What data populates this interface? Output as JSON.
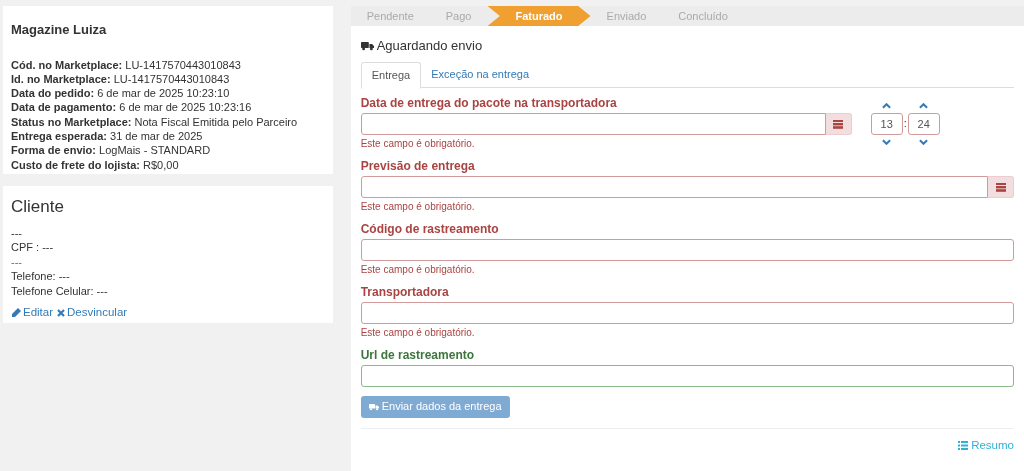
{
  "marketplace": {
    "title": "Magazine Luiza",
    "details": [
      {
        "label": "Cód. no Marketplace:",
        "value": "LU-1417570443010843"
      },
      {
        "label": "Id. no Marketplace:",
        "value": "LU-1417570443010843"
      },
      {
        "label": "Data do pedido:",
        "value": "6 de mar de 2025 10:23:10"
      },
      {
        "label": "Data de pagamento:",
        "value": "6 de mar de 2025 10:23:16"
      },
      {
        "label": "Status no Marketplace:",
        "value": "Nota Fiscal Emitida pelo Parceiro"
      },
      {
        "label": "Entrega esperada:",
        "value": "31 de mar de 2025"
      },
      {
        "label": "Forma de envio:",
        "value": "LogMais - STANDARD"
      },
      {
        "label": "Custo de frete do lojista:",
        "value": "R$0,00"
      }
    ]
  },
  "client": {
    "title": "Cliente",
    "lines": [
      {
        "text": "---",
        "kind": "plain"
      },
      {
        "text": "CPF : ---",
        "kind": "plain"
      },
      {
        "text": "---",
        "kind": "link"
      },
      {
        "text": "Telefone: ---",
        "kind": "plain"
      },
      {
        "text": "Telefone Celular: ---",
        "kind": "plain"
      }
    ],
    "actions": [
      {
        "label": "Editar",
        "kind": "edit"
      },
      {
        "label": "Desvincular",
        "kind": "unlink"
      }
    ]
  },
  "steps": [
    {
      "label": "Pendente",
      "selected": false
    },
    {
      "label": "Pago",
      "selected": false
    },
    {
      "label": "Faturado",
      "selected": true
    },
    {
      "label": "Enviado",
      "selected": false
    },
    {
      "label": "Concluído",
      "selected": false
    }
  ],
  "status_title": "Aguardando envio",
  "tabs": [
    {
      "label": "Entrega",
      "selected": true
    },
    {
      "label": "Exceção na entrega",
      "selected": false
    }
  ],
  "fields": [
    {
      "label": "Data de entrega do pacote na transportadora",
      "kind": "datetime",
      "invalid": true,
      "error": "Este campo é obrigatório.",
      "hours": "13",
      "minutes": "24",
      "separator": ":"
    },
    {
      "label": "Previsão de entrega",
      "kind": "date",
      "invalid": true,
      "error": "Este campo é obrigatório."
    },
    {
      "label": "Código de rastreamento",
      "kind": "text",
      "invalid": true,
      "error": "Este campo é obrigatório."
    },
    {
      "label": "Transportadora",
      "kind": "text",
      "invalid": true,
      "error": "Este campo é obrigatório."
    },
    {
      "label": "Url de rastreamento",
      "kind": "text",
      "invalid": false
    }
  ],
  "submit": {
    "label": "Enviar dados da entrega",
    "disabled": true
  },
  "summary_link": "Resumo"
}
